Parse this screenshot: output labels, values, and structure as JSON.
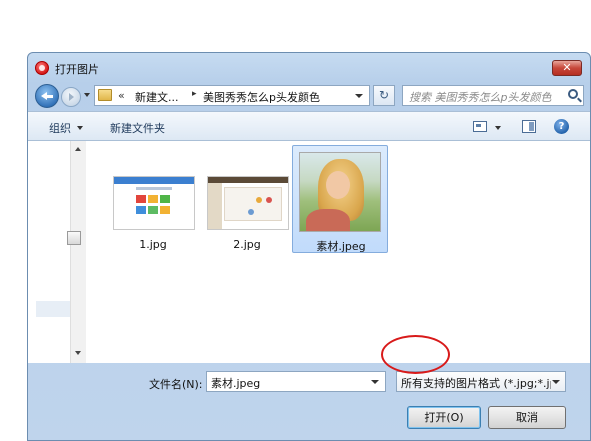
{
  "window": {
    "title": "打开图片",
    "close_label": "✕"
  },
  "address_bar": {
    "prefix": "«",
    "crumbs": [
      "新建文...",
      "美图秀秀怎么p头发颜色"
    ],
    "search_placeholder": "搜索 美图秀秀怎么p头发颜色"
  },
  "toolbar": {
    "organize_label": "组织",
    "new_folder_label": "新建文件夹",
    "help_label": "?"
  },
  "files": [
    {
      "name": "1.jpg",
      "selected": false
    },
    {
      "name": "2.jpg",
      "selected": false
    },
    {
      "name": "素材.jpeg",
      "selected": true
    }
  ],
  "bottom": {
    "filename_label": "文件名(N):",
    "filename_value": "素材.jpeg",
    "filetype_value": "所有支持的图片格式 (*.jpg;*.jp",
    "open_label": "打开(O)",
    "cancel_label": "取消"
  },
  "colors": {
    "accent": "#3b7fd0",
    "annotation_ring": "#d81a1a",
    "selection": "#c1dbfb"
  }
}
